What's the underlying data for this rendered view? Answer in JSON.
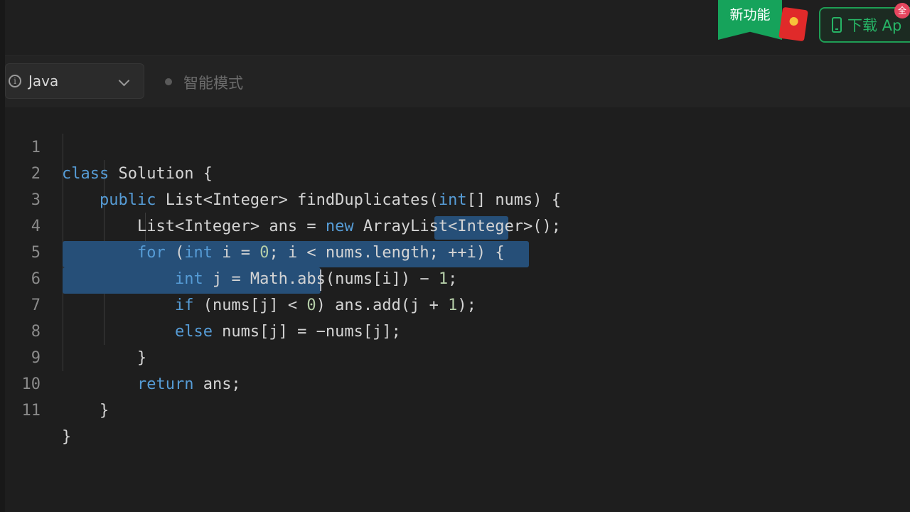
{
  "topbar": {
    "new_feature": "新功能",
    "download_label": "下载 Ap",
    "badge": "全"
  },
  "toolbar": {
    "language": "Java",
    "smart_mode": "智能模式"
  },
  "code": {
    "lines": [
      {
        "num": "1",
        "text": "class Solution {"
      },
      {
        "num": "2",
        "text": "    public List<Integer> findDuplicates(int[] nums) {"
      },
      {
        "num": "3",
        "text": "        List<Integer> ans = new ArrayList<Integer>();"
      },
      {
        "num": "4",
        "text": "        for (int i = 0; i < nums.length; ++i) {"
      },
      {
        "num": "5",
        "text": "            int j = Math.abs(nums[i]) − 1;"
      },
      {
        "num": "6",
        "text": "            if (nums[j] < 0) ans.add(j + 1);"
      },
      {
        "num": "7",
        "text": "            else nums[j] = −nums[j];"
      },
      {
        "num": "8",
        "text": "        }"
      },
      {
        "num": "9",
        "text": "        return ans;"
      },
      {
        "num": "10",
        "text": "    }"
      },
      {
        "num": "11",
        "text": "}"
      }
    ]
  },
  "colors": {
    "keyword": "#569cd6",
    "number": "#b5cea8",
    "selection": "#264f78",
    "accent_green": "#16a35b"
  }
}
